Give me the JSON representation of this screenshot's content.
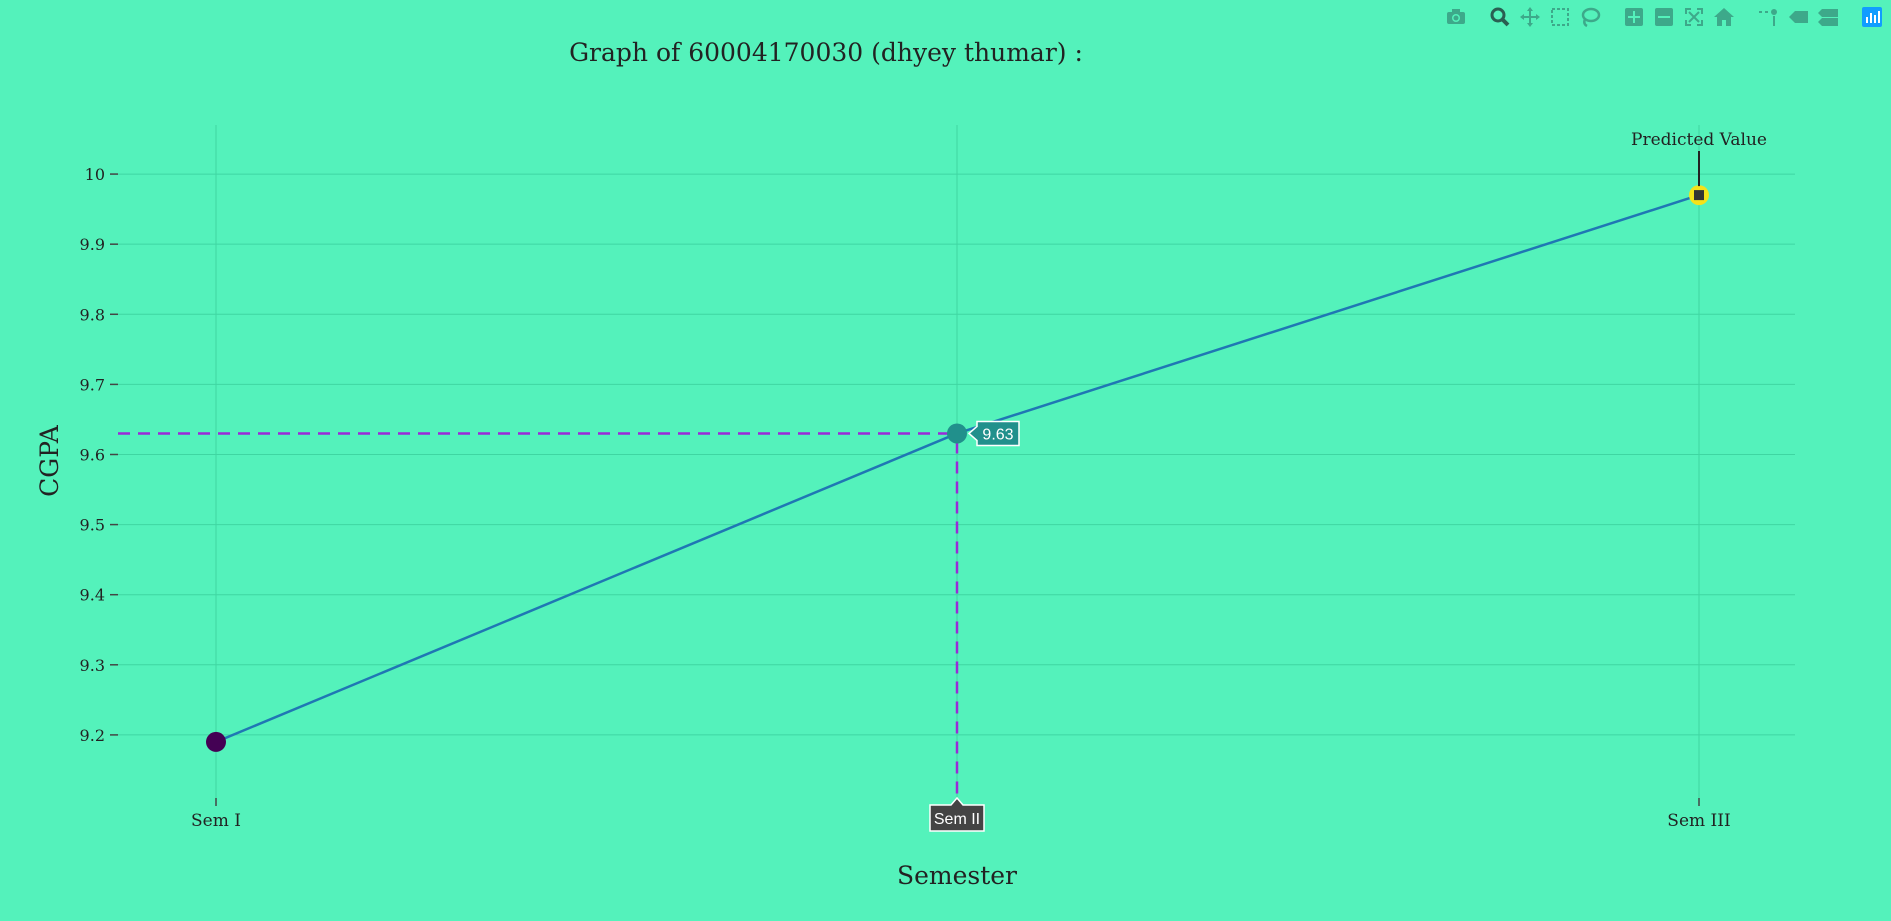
{
  "chart_data": {
    "type": "line",
    "title": "Graph of 60004170030  (dhyey thumar) :",
    "xlabel": "Semester",
    "ylabel": "CGPA",
    "categories": [
      "Sem I",
      "Sem II",
      "Sem III"
    ],
    "values": [
      9.19,
      9.63,
      9.97
    ],
    "ylim": [
      9.11,
      10.07
    ],
    "yticks": [
      9.2,
      9.3,
      9.4,
      9.5,
      9.6,
      9.7,
      9.8,
      9.9,
      10
    ],
    "ytick_labels": [
      "9.2",
      "9.3",
      "9.4",
      "9.5",
      "9.6",
      "9.7",
      "9.8",
      "9.9",
      "10"
    ],
    "grid": true,
    "marker_colors": [
      "#440154",
      "#21908c",
      "#f5e21a"
    ],
    "line_color": "#1f77b4",
    "annotation": {
      "text": "Predicted Value",
      "point_index": 2
    },
    "hover": {
      "point_index": 1,
      "y_label": "9.63",
      "x_label": "Sem II",
      "spike_color": "#9a2bd8"
    }
  },
  "toolbar": {
    "buttons": [
      {
        "name": "camera-icon",
        "group": 0
      },
      {
        "name": "zoom-icon",
        "group": 1,
        "active": true
      },
      {
        "name": "pan-icon",
        "group": 1
      },
      {
        "name": "box-select-icon",
        "group": 1
      },
      {
        "name": "lasso-select-icon",
        "group": 1
      },
      {
        "name": "zoom-in-icon",
        "group": 2
      },
      {
        "name": "zoom-out-icon",
        "group": 2
      },
      {
        "name": "autoscale-icon",
        "group": 2
      },
      {
        "name": "home-icon",
        "group": 2
      },
      {
        "name": "spike-lines-icon",
        "group": 3
      },
      {
        "name": "hover-closest-icon",
        "group": 3
      },
      {
        "name": "hover-compare-icon",
        "group": 3
      },
      {
        "name": "plotly-logo-icon",
        "group": 4
      }
    ],
    "icon_color": "#3da98a",
    "active_color": "#2a5f52",
    "logo_color": "#119dff"
  }
}
